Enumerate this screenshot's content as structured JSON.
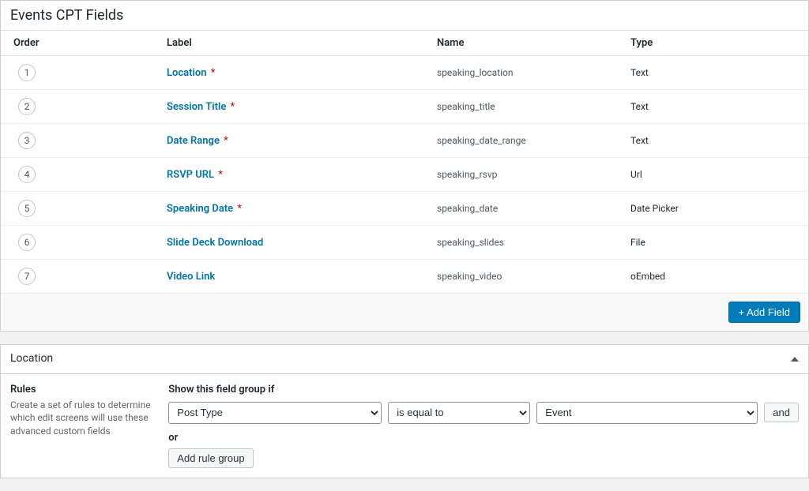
{
  "fieldsPanel": {
    "title": "Events CPT Fields",
    "columns": {
      "order": "Order",
      "label": "Label",
      "name": "Name",
      "type": "Type"
    },
    "rows": [
      {
        "order": "1",
        "label": "Location",
        "required": true,
        "name": "speaking_location",
        "type": "Text"
      },
      {
        "order": "2",
        "label": "Session Title",
        "required": true,
        "name": "speaking_title",
        "type": "Text"
      },
      {
        "order": "3",
        "label": "Date Range",
        "required": true,
        "name": "speaking_date_range",
        "type": "Text"
      },
      {
        "order": "4",
        "label": "RSVP URL",
        "required": true,
        "name": "speaking_rsvp",
        "type": "Url"
      },
      {
        "order": "5",
        "label": "Speaking Date",
        "required": true,
        "name": "speaking_date",
        "type": "Date Picker"
      },
      {
        "order": "6",
        "label": "Slide Deck Download",
        "required": false,
        "name": "speaking_slides",
        "type": "File"
      },
      {
        "order": "7",
        "label": "Video Link",
        "required": false,
        "name": "speaking_video",
        "type": "oEmbed"
      }
    ],
    "required_marker": "*",
    "addFieldLabel": "+ Add Field"
  },
  "locationPanel": {
    "title": "Location",
    "rulesTitle": "Rules",
    "rulesDesc": "Create a set of rules to determine which edit screens will use these advanced custom fields",
    "showIfLabel": "Show this field group if",
    "param": "Post Type",
    "operator": "is equal to",
    "value": "Event",
    "andLabel": "and",
    "orLabel": "or",
    "addRuleGroupLabel": "Add rule group"
  }
}
